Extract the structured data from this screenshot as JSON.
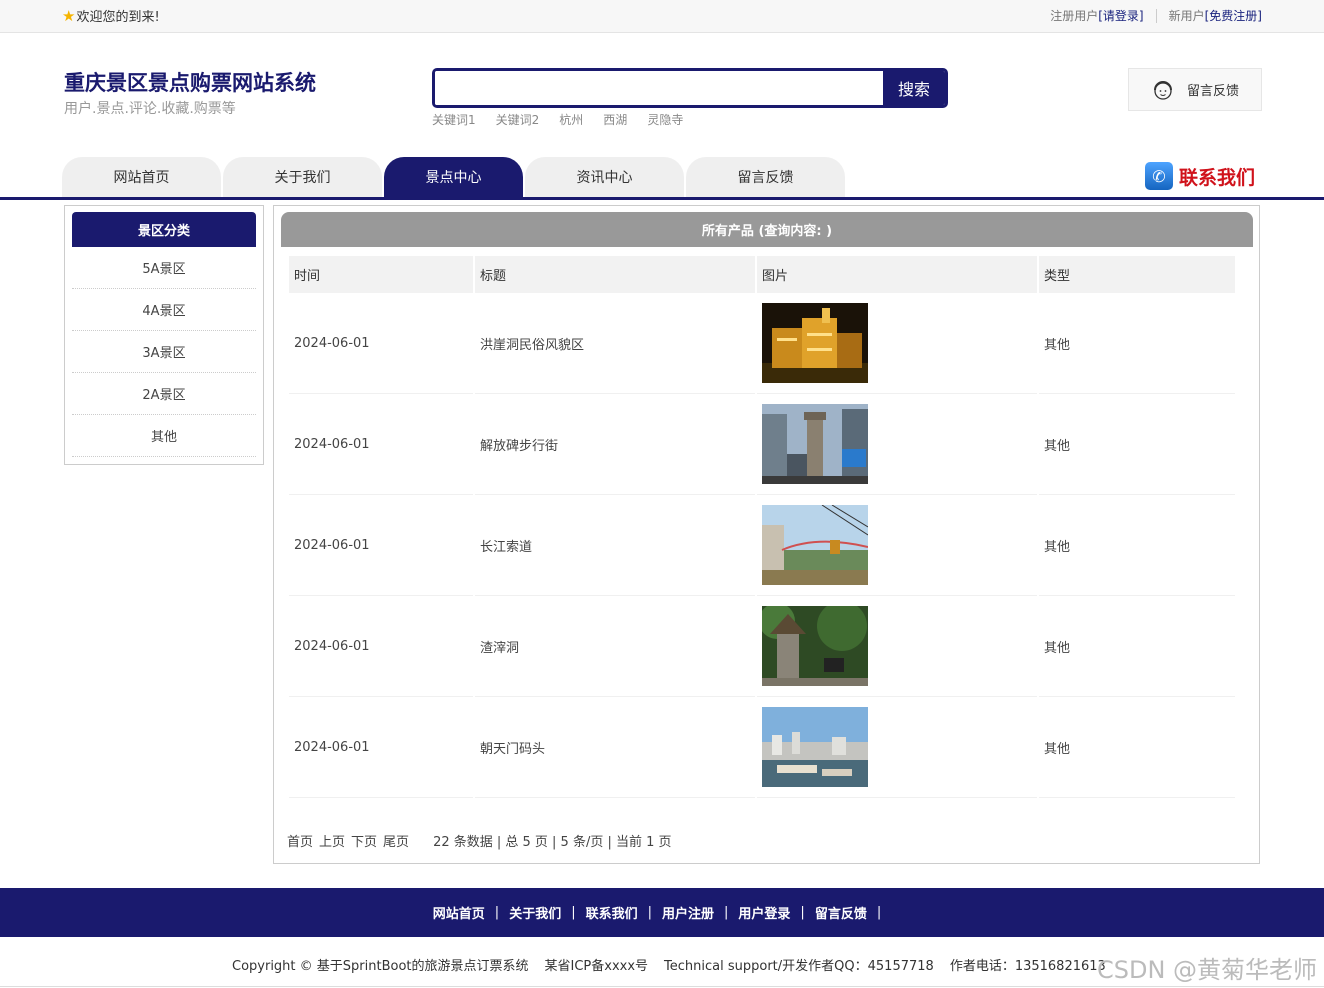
{
  "topbar": {
    "welcome": "欢迎您的到来!",
    "register_prefix": "注册用户",
    "login_link": "[请登录]",
    "new_prefix": "新用户",
    "register_link": "[免费注册]"
  },
  "header": {
    "title": "重庆景区景点购票网站系统",
    "subtitle": "用户.景点.评论.收藏.购票等",
    "search_button": "搜索",
    "keywords": [
      "关键词1",
      "关键词2",
      "杭州",
      "西湖",
      "灵隐寺"
    ],
    "feedback": "留言反馈"
  },
  "nav": {
    "tabs": [
      "网站首页",
      "关于我们",
      "景点中心",
      "资讯中心",
      "留言反馈"
    ],
    "active": "景点中心",
    "contact": "联系我们"
  },
  "sidebar": {
    "title": "景区分类",
    "items": [
      "5A景区",
      "4A景区",
      "3A景区",
      "2A景区",
      "其他"
    ]
  },
  "main": {
    "title": "所有产品 (查询内容: )",
    "columns": [
      "时间",
      "标题",
      "图片",
      "类型"
    ],
    "rows": [
      {
        "time": "2024-06-01",
        "title": "洪崖洞民俗风貌区",
        "type": "其他",
        "image": "night-city-photo"
      },
      {
        "time": "2024-06-01",
        "title": "解放碑步行街",
        "type": "其他",
        "image": "street-tower-photo"
      },
      {
        "time": "2024-06-01",
        "title": "长江索道",
        "type": "其他",
        "image": "cable-car-photo"
      },
      {
        "time": "2024-06-01",
        "title": "渣滓洞",
        "type": "其他",
        "image": "stone-tower-photo"
      },
      {
        "time": "2024-06-01",
        "title": "朝天门码头",
        "type": "其他",
        "image": "harbor-photo"
      }
    ],
    "pager": {
      "first": "首页",
      "prev": "上页",
      "next": "下页",
      "last": "尾页",
      "summary": "22 条数据 | 总 5 页 | 5 条/页 | 当前 1 页"
    }
  },
  "footer": {
    "links": [
      "网站首页",
      "关于我们",
      "联系我们",
      "用户注册",
      "用户登录",
      "留言反馈"
    ],
    "copyright": "Copyright © 基于SprintBoot的旅游景点订票系统",
    "icp": "某省ICP备xxxx号",
    "support": "Technical support/开发作者QQ：45157718",
    "phone": "作者电话：13516821613",
    "watermark": "CSDN @黄菊华老师"
  },
  "colors": {
    "brand": "#1a1a6e",
    "contact_red": "#d0121b",
    "panel_gray": "#999999"
  }
}
